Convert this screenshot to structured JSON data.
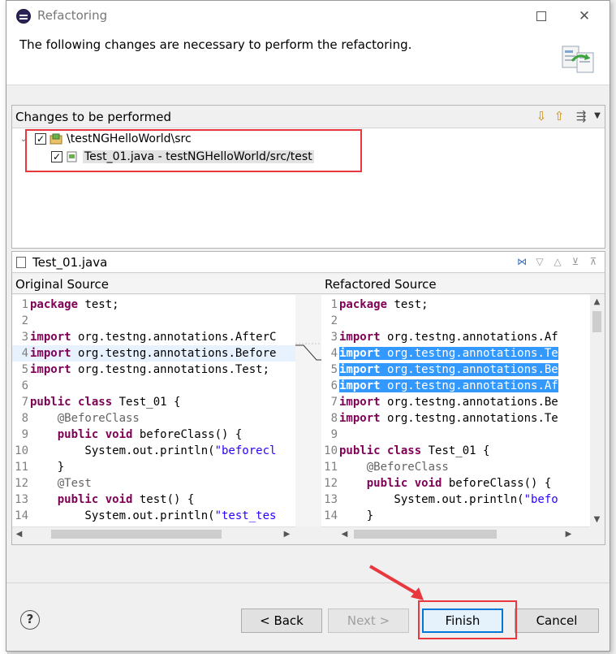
{
  "window": {
    "title": "Refactoring"
  },
  "header": {
    "message": "The following changes are necessary to perform the refactoring."
  },
  "changes": {
    "heading": "Changes to be performed",
    "items": [
      {
        "label": "\\testNGHelloWorld\\src",
        "checked": true
      },
      {
        "label": "Test_01.java - testNGHelloWorld/src/test",
        "checked": true
      }
    ]
  },
  "compare": {
    "file_name": "Test_01.java",
    "left_title": "Original Source",
    "right_title": "Refactored Source",
    "left_lines": [
      {
        "n": "1",
        "kw": "package",
        "rest": " test;"
      },
      {
        "n": "2",
        "kw": "",
        "rest": ""
      },
      {
        "n": "3",
        "kw": "import",
        "rest": " org.testng.annotations.AfterC"
      },
      {
        "n": "4",
        "kw": "import",
        "rest": " org.testng.annotations.Before"
      },
      {
        "n": "5",
        "kw": "import",
        "rest": " org.testng.annotations.Test;"
      },
      {
        "n": "6",
        "kw": "",
        "rest": ""
      },
      {
        "n": "7",
        "kw": "public class",
        "rest": " Test_01 {"
      },
      {
        "n": "8",
        "kw": "",
        "rest": "    @BeforeClass"
      },
      {
        "n": "9",
        "kw": "    public void",
        "rest": " beforeClass() {"
      },
      {
        "n": "10",
        "kw": "",
        "rest": "        System.out.println(",
        "str": "\"beforecl"
      },
      {
        "n": "11",
        "kw": "",
        "rest": "    }"
      },
      {
        "n": "12",
        "kw": "",
        "rest": "    @Test"
      },
      {
        "n": "13",
        "kw": "    public void",
        "rest": " test() {"
      },
      {
        "n": "14",
        "kw": "",
        "rest": "        System.out.println(",
        "str": "\"test_tes"
      }
    ],
    "right_lines": [
      {
        "n": "1",
        "kw": "package",
        "rest": " test;"
      },
      {
        "n": "2",
        "kw": "",
        "rest": ""
      },
      {
        "n": "3",
        "kw": "import",
        "rest": " org.testng.annotations.Af"
      },
      {
        "n": "4",
        "kw": "import",
        "rest": " org.testng.annotations.Te"
      },
      {
        "n": "5",
        "kw": "import",
        "rest": " org.testng.annotations.Be"
      },
      {
        "n": "6",
        "kw": "import",
        "rest": " org.testng.annotations.Af"
      },
      {
        "n": "7",
        "kw": "import",
        "rest": " org.testng.annotations.Be"
      },
      {
        "n": "8",
        "kw": "import",
        "rest": " org.testng.annotations.Te"
      },
      {
        "n": "9",
        "kw": "",
        "rest": ""
      },
      {
        "n": "10",
        "kw": "public class",
        "rest": " Test_01 {"
      },
      {
        "n": "11",
        "kw": "",
        "rest": "    @BeforeClass"
      },
      {
        "n": "12",
        "kw": "    public void",
        "rest": " beforeClass() {"
      },
      {
        "n": "13",
        "kw": "",
        "rest": "        System.out.println(",
        "str": "\"befo"
      },
      {
        "n": "14",
        "kw": "",
        "rest": "    }"
      }
    ]
  },
  "buttons": {
    "help": "?",
    "back": "< Back",
    "next": "Next >",
    "finish": "Finish",
    "cancel": "Cancel"
  },
  "colors": {
    "keyword": "#7f0055",
    "string": "#2a00ff",
    "selection": "#3399ff",
    "annotation_box": "#e8383d",
    "default_button": "#0078d7"
  }
}
